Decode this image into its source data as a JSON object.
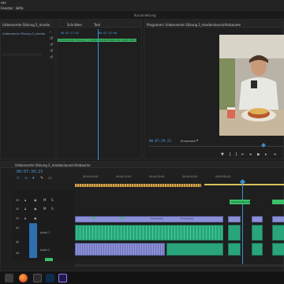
{
  "menu": {
    "items": [
      "ren",
      "Fenster",
      "Hilfe"
    ]
  },
  "window": {
    "title": "Kurzanleitung"
  },
  "project": {
    "tab": "Unbenannte Sitzung 2_mixdaniaunsichtsbaume",
    "rows": [
      "Unbenannte Sitzung 2_mixdaniaunsichtsbaume"
    ]
  },
  "source": {
    "tabs": [
      "Schnitten",
      "Text"
    ],
    "timecodes": [
      "00:07:17:02",
      "00:07:42:00"
    ],
    "clip_label": "Unbenannte Sitzung 2_mixdaniaunsichtsbaume Audio Bearbeitungs"
  },
  "program": {
    "title": "Programm: Unbenannte Sitzung 2_mixdaniaunsichtsbaume",
    "timecode": "00:07:39:23",
    "fit": "Einpassen"
  },
  "timeline": {
    "tab": "Unbenannte Sitzung 2_mixdaniaunsichtsbaume",
    "timecode": "00:07:39:23",
    "ruler": [
      "00:04:00:00",
      "00:04:15:00",
      "00:04:30:00",
      "00:04:45:00",
      "00:05:00:00"
    ],
    "clip_labels": [
      "Forschung",
      "Forschung",
      "Forschung",
      "Forschung",
      "Verschiedene Szene"
    ],
    "tracks": [
      "V3",
      "V2",
      "V1",
      "A1",
      "A2",
      "A3"
    ],
    "track_names": [
      "Audio 1",
      "Audio 2"
    ]
  },
  "taskbar": {
    "apps": [
      "files-icon",
      "firefox-icon",
      "media-icon",
      "lightroom-icon",
      "premiere-icon"
    ]
  }
}
